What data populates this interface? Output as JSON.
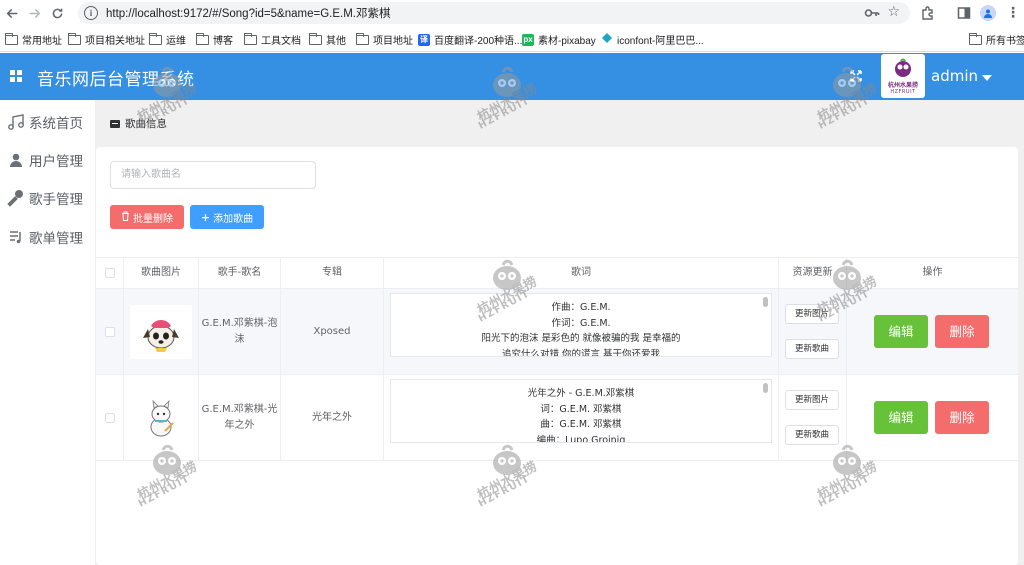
{
  "browser": {
    "url": "http://localhost:9172/#/Song?id=5&name=G.E.M.邓紫棋",
    "bookmarks": [
      {
        "label": "常用地址"
      },
      {
        "label": "项目相关地址"
      },
      {
        "label": "运维"
      },
      {
        "label": "博客"
      },
      {
        "label": "工具文档"
      },
      {
        "label": "其他"
      },
      {
        "label": "项目地址"
      },
      {
        "label": "百度翻译-200种语..."
      },
      {
        "label": "素材-pixabay"
      },
      {
        "label": "iconfont-阿里巴巴..."
      },
      {
        "label": "所有书签"
      }
    ]
  },
  "header": {
    "title": "音乐网后台管理系统",
    "user": "admin",
    "logo_text": "杭州水果捞",
    "logo_sub": "HZFRUIT",
    "accent_color": "#358fe3"
  },
  "sidebar": {
    "items": [
      {
        "label": "系统首页",
        "icon": "music-note-icon"
      },
      {
        "label": "用户管理",
        "icon": "user-icon"
      },
      {
        "label": "歌手管理",
        "icon": "microphone-icon"
      },
      {
        "label": "歌单管理",
        "icon": "playlist-icon"
      }
    ]
  },
  "main": {
    "breadcrumb": "歌曲信息",
    "search_placeholder": "请输入歌曲名",
    "batch_delete": "批量删除",
    "add_song": "添加歌曲",
    "columns": [
      "歌曲图片",
      "歌手-歌名",
      "专辑",
      "歌词",
      "资源更新",
      "操作"
    ],
    "rows": [
      {
        "singer_song": "G.E.M.邓紫棋-泡沫",
        "album": "Xposed",
        "lyrics": [
          "作曲：G.E.M.",
          "作词：G.E.M.",
          "阳光下的泡沫 是彩色的 就像被骗的我 是幸福的",
          "追究什么对错 你的谎言 基于你还爱我"
        ],
        "update_pic": "更新图片",
        "update_song": "更新歌曲",
        "edit": "编辑",
        "delete": "删除"
      },
      {
        "singer_song": "G.E.M.邓紫棋-光年之外",
        "album": "光年之外",
        "lyrics": [
          "光年之外 - G.E.M.邓紫棋",
          "词：G.E.M. 邓紫棋",
          "曲：G.E.M. 邓紫棋",
          "编曲：Lupo Groinig"
        ],
        "update_pic": "更新图片",
        "update_song": "更新歌曲",
        "edit": "编辑",
        "delete": "删除"
      }
    ]
  },
  "watermark": {
    "text": "杭州水果捞",
    "sub": "HZFRUIT"
  }
}
